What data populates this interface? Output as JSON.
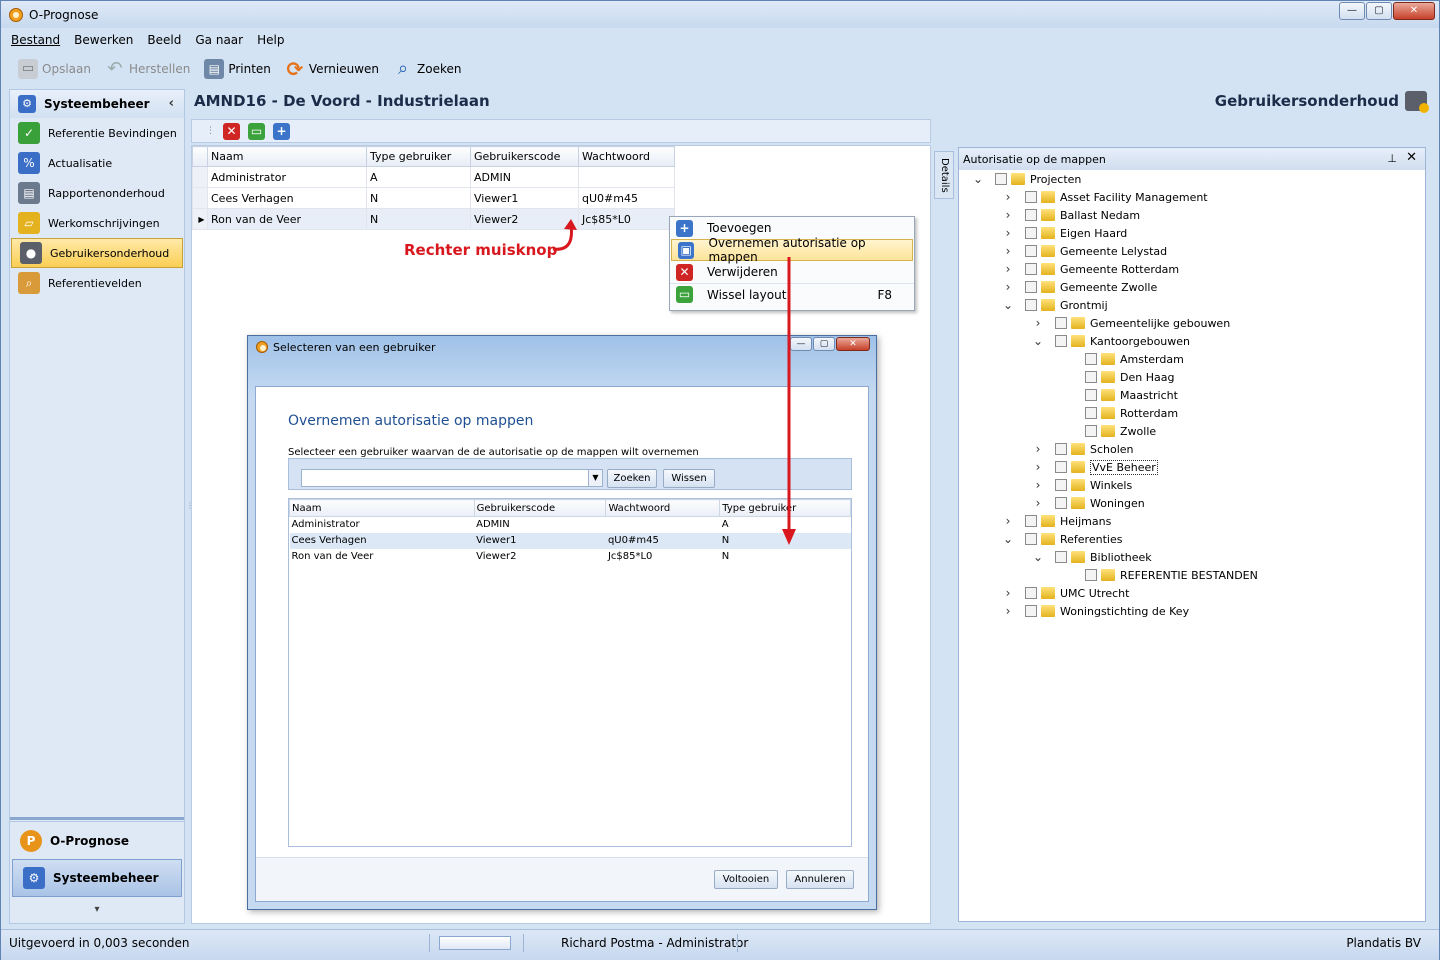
{
  "window": {
    "title": "O-Prognose",
    "buttons": [
      "—",
      "▢",
      "✕"
    ]
  },
  "menu": [
    "Bestand",
    "Bewerken",
    "Beeld",
    "Ga naar",
    "Help"
  ],
  "toolbar": [
    {
      "label": "Opslaan",
      "icon": "save-icon",
      "disabled": true
    },
    {
      "label": "Herstellen",
      "icon": "undo-icon",
      "disabled": true
    },
    {
      "label": "Printen",
      "icon": "print-icon"
    },
    {
      "label": "Vernieuwen",
      "icon": "refresh-icon"
    },
    {
      "label": "Zoeken",
      "icon": "search-icon"
    }
  ],
  "sidebar": {
    "title": "Systeembeheer",
    "collapse": "‹",
    "items": [
      {
        "label": "Referentie Bevindingen",
        "icon": "folder-check-icon",
        "color": "#3aa03a"
      },
      {
        "label": "Actualisatie",
        "icon": "percent-icon",
        "color": "#3b6ec7"
      },
      {
        "label": "Rapportenonderhoud",
        "icon": "report-icon",
        "color": "#6c7a8e"
      },
      {
        "label": "Werkomschrijvingen",
        "icon": "folder-icon",
        "color": "#e3b21e"
      },
      {
        "label": "Gebruikersonderhoud",
        "icon": "user-folder-icon",
        "color": "#5a5f69",
        "active": true
      },
      {
        "label": "Referentievelden",
        "icon": "folder-search-icon",
        "color": "#d99a3a"
      }
    ],
    "bottom": [
      {
        "label": "O-Prognose",
        "icon": "prognose-icon"
      },
      {
        "label": "Systeembeheer",
        "icon": "gear-icon",
        "active": true
      }
    ],
    "footer": "▾"
  },
  "main": {
    "title": "AMND16 - De Voord - Industrielaan",
    "section_title": "Gebruikersonderhoud",
    "grid": {
      "columns": [
        "Naam",
        "Type gebruiker",
        "Gebruikerscode",
        "Wachtwoord"
      ],
      "rows": [
        {
          "naam": "Administrator",
          "type": "A",
          "code": "ADMIN",
          "ww": ""
        },
        {
          "naam": "Cees Verhagen",
          "type": "N",
          "code": "Viewer1",
          "ww": "qU0#m45"
        },
        {
          "naam": "Ron van de Veer",
          "type": "N",
          "code": "Viewer2",
          "ww": "Jc$85*L0",
          "selected": true
        }
      ]
    },
    "annotation": "Rechter muisknop",
    "context_menu": [
      {
        "label": "Toevoegen",
        "icon": "add-icon"
      },
      {
        "label": "Overnemen autorisatie op mappen",
        "icon": "copy-rights-icon",
        "highlighted": true
      },
      {
        "label": "Verwijderen",
        "icon": "delete-icon"
      },
      {
        "label": "Wissel layout",
        "icon": "layout-icon",
        "shortcut": "F8"
      }
    ]
  },
  "details_tab": "Details",
  "right_panel": {
    "title": "Autorisatie op de mappen",
    "pin": "📌",
    "close": "✕",
    "tree": [
      {
        "label": "Projecten",
        "level": 0,
        "exp": "down"
      },
      {
        "label": "Asset Facility Management",
        "level": 1,
        "exp": "right"
      },
      {
        "label": "Ballast Nedam",
        "level": 1,
        "exp": "right"
      },
      {
        "label": "Eigen Haard",
        "level": 1,
        "exp": "right"
      },
      {
        "label": "Gemeente Lelystad",
        "level": 1,
        "exp": "right"
      },
      {
        "label": "Gemeente Rotterdam",
        "level": 1,
        "exp": "right"
      },
      {
        "label": "Gemeente Zwolle",
        "level": 1,
        "exp": "right"
      },
      {
        "label": "Grontmij",
        "level": 1,
        "exp": "down"
      },
      {
        "label": "Gemeentelijke gebouwen",
        "level": 2,
        "exp": "right"
      },
      {
        "label": "Kantoorgebouwen",
        "level": 2,
        "exp": "down"
      },
      {
        "label": "Amsterdam",
        "level": 3,
        "exp": ""
      },
      {
        "label": "Den Haag",
        "level": 3,
        "exp": ""
      },
      {
        "label": "Maastricht",
        "level": 3,
        "exp": ""
      },
      {
        "label": "Rotterdam",
        "level": 3,
        "exp": ""
      },
      {
        "label": "Zwolle",
        "level": 3,
        "exp": ""
      },
      {
        "label": "Scholen",
        "level": 2,
        "exp": "right"
      },
      {
        "label": "VvE Beheer",
        "level": 2,
        "exp": "right",
        "focused": true
      },
      {
        "label": "Winkels",
        "level": 2,
        "exp": "right"
      },
      {
        "label": "Woningen",
        "level": 2,
        "exp": "right"
      },
      {
        "label": "Heijmans",
        "level": 1,
        "exp": "right"
      },
      {
        "label": "Referenties",
        "level": 1,
        "exp": "down"
      },
      {
        "label": "Bibliotheek",
        "level": 2,
        "exp": "down"
      },
      {
        "label": "REFERENTIE BESTANDEN",
        "level": 3,
        "exp": ""
      },
      {
        "label": "UMC Utrecht",
        "level": 1,
        "exp": "right"
      },
      {
        "label": "Woningstichting de Key",
        "level": 1,
        "exp": "right"
      }
    ]
  },
  "dialog": {
    "title": "Selecteren van een gebruiker",
    "heading": "Overnemen autorisatie op mappen",
    "subtitle": "Selecteer een gebruiker waarvan de de autorisatie op de mappen wilt overnemen",
    "search_value": "",
    "search_button": "Zoeken",
    "clear_button": "Wissen",
    "columns": [
      "Naam",
      "Gebruikerscode",
      "Wachtwoord",
      "Type gebruiker"
    ],
    "rows": [
      {
        "naam": "Administrator",
        "code": "ADMIN",
        "ww": "",
        "type": "A"
      },
      {
        "naam": "Cees Verhagen",
        "code": "Viewer1",
        "ww": "qU0#m45",
        "type": "N",
        "selected": true
      },
      {
        "naam": "Ron van de Veer",
        "code": "Viewer2",
        "ww": "Jc$85*L0",
        "type": "N"
      }
    ],
    "finish_button": "Voltooien",
    "cancel_button": "Annuleren"
  },
  "status": {
    "left": "Uitgevoerd in 0,003 seconden",
    "user": "Richard Postma - Administrator",
    "company": "Plandatis BV"
  },
  "colors": {
    "annotation": "#d8181e",
    "accent": "#3b6ec7",
    "active": "#fbcf55"
  }
}
